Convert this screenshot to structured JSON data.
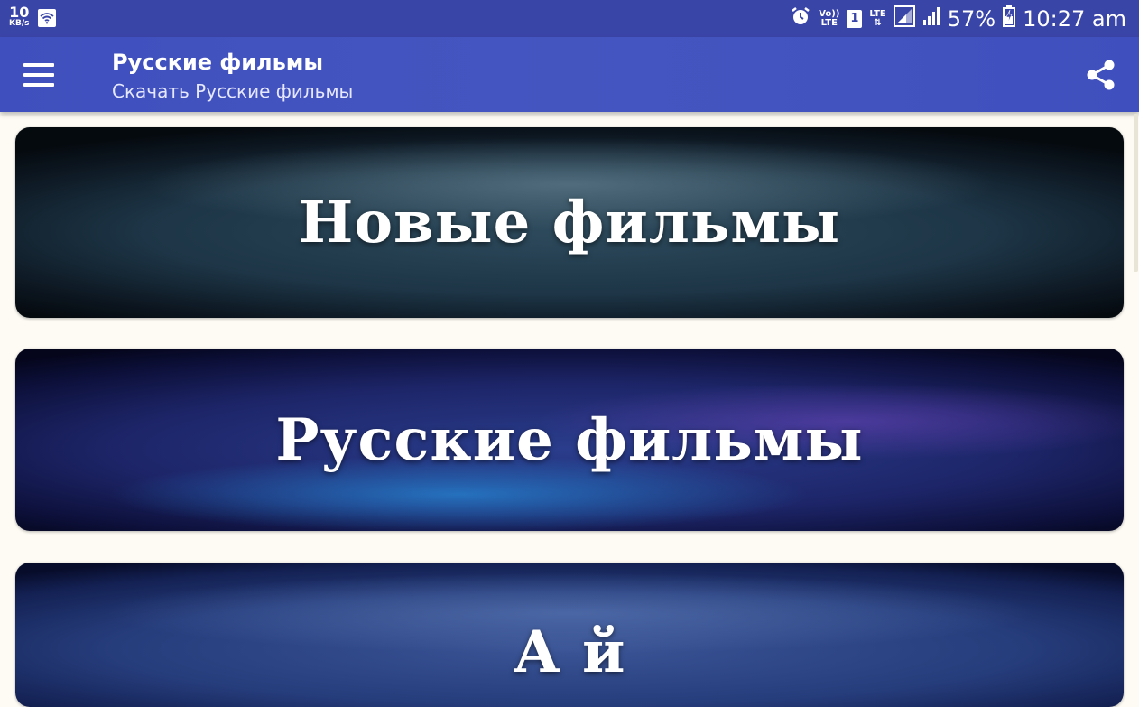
{
  "status_bar": {
    "network_speed_value": "10",
    "network_speed_unit": "KB/s",
    "volte_top": "Vo))",
    "volte_bottom": "LTE",
    "sim_slot": "1",
    "lte_label": "LTE",
    "battery_percent": "57%",
    "time": "10:27 am"
  },
  "app_bar": {
    "title": "Русские фильмы",
    "subtitle": "Скачать Русские фильмы"
  },
  "categories": [
    {
      "label": "Новые фильмы"
    },
    {
      "label": "Русские фильмы"
    },
    {
      "label": "А      й"
    }
  ],
  "colors": {
    "status_bar": "#3a45a8",
    "app_bar": "#4555c0",
    "background": "#fdfbf3"
  }
}
